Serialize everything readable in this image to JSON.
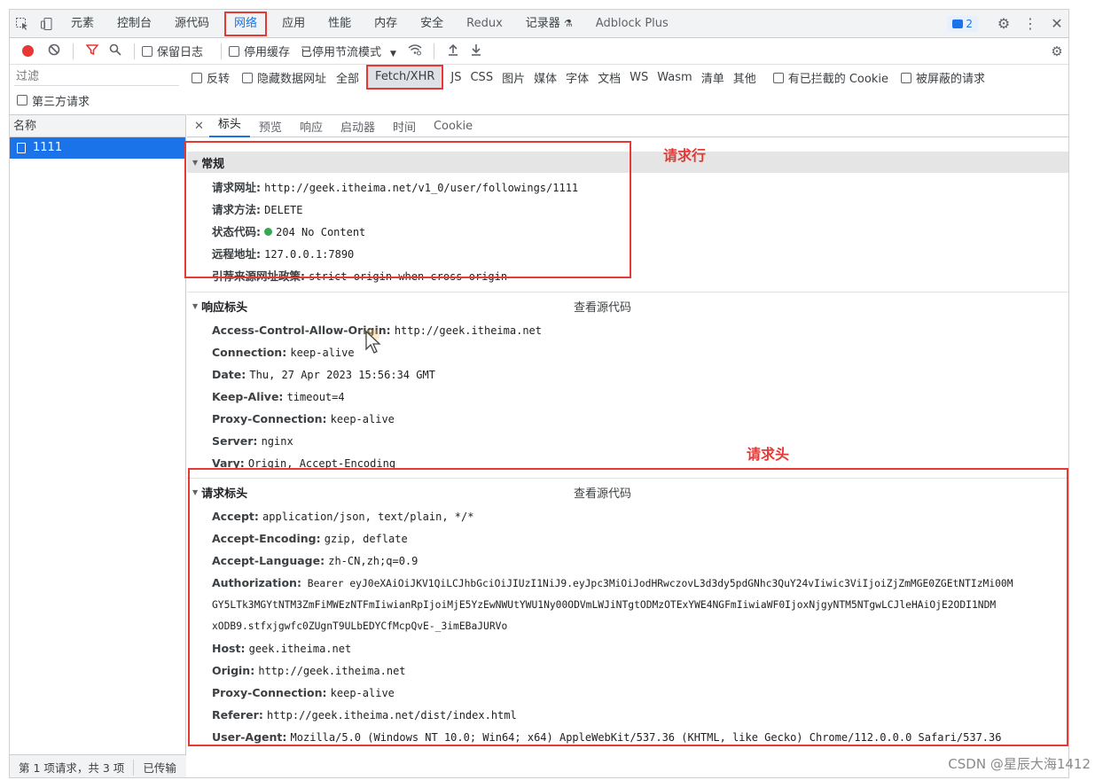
{
  "tabs": {
    "items": [
      "元素",
      "控制台",
      "源代码",
      "网络",
      "应用",
      "性能",
      "内存",
      "安全",
      "Redux",
      "记录器",
      "Adblock Plus"
    ],
    "active": "网络",
    "badge_count": "2"
  },
  "toolbar": {
    "preserve_log": "保留日志",
    "disable_cache": "停用缓存",
    "throttle": "已停用节流模式"
  },
  "filter": {
    "placeholder": "过滤",
    "invert": "反转",
    "hide_data_urls": "隐藏数据网址",
    "types": [
      "全部",
      "Fetch/XHR",
      "JS",
      "CSS",
      "图片",
      "媒体",
      "字体",
      "文档",
      "WS",
      "Wasm",
      "清单",
      "其他"
    ],
    "active_type": "Fetch/XHR",
    "blocked_cookies": "有已拦截的 Cookie",
    "blocked_requests": "被屏蔽的请求",
    "third_party": "第三方请求"
  },
  "list": {
    "header": "名称",
    "request_name": "1111"
  },
  "status": {
    "summary": "第 1 项请求，共 3 项",
    "transferred": "已传输"
  },
  "detail_tabs": [
    "标头",
    "预览",
    "响应",
    "启动器",
    "时间",
    "Cookie"
  ],
  "general": {
    "title": "常规",
    "request_url_key": "请求网址:",
    "request_url": "http://geek.itheima.net/v1_0/user/followings/1111",
    "method_key": "请求方法:",
    "method": "DELETE",
    "status_key": "状态代码:",
    "status": "204 No Content",
    "remote_key": "远程地址:",
    "remote": "127.0.0.1:7890",
    "referrer_policy_key": "引荐来源网址政策:",
    "referrer_policy": "strict-origin-when-cross-origin"
  },
  "response_headers": {
    "title": "响应标头",
    "view_source": "查看源代码",
    "items": [
      {
        "k": "Access-Control-Allow-Origin:",
        "v": "http://geek.itheima.net"
      },
      {
        "k": "Connection:",
        "v": "keep-alive"
      },
      {
        "k": "Date:",
        "v": "Thu, 27 Apr 2023 15:56:34 GMT"
      },
      {
        "k": "Keep-Alive:",
        "v": "timeout=4"
      },
      {
        "k": "Proxy-Connection:",
        "v": "keep-alive"
      },
      {
        "k": "Server:",
        "v": "nginx"
      },
      {
        "k": "Vary:",
        "v": "Origin, Accept-Encoding"
      }
    ]
  },
  "request_headers": {
    "title": "请求标头",
    "view_source": "查看源代码",
    "accept_k": "Accept:",
    "accept_v": "application/json, text/plain, */*",
    "accept_enc_k": "Accept-Encoding:",
    "accept_enc_v": "gzip, deflate",
    "accept_lang_k": "Accept-Language:",
    "accept_lang_v": "zh-CN,zh;q=0.9",
    "auth_k": "Authorization:",
    "auth_v1": "Bearer eyJ0eXAiOiJKV1QiLCJhbGciOiJIUzI1NiJ9.eyJpc3MiOiJodHRwczovL3d3dy5pdGNhc3QuY24vIiwic3ViIjoiZjZmMGE0ZGEtNTIzMi00M",
    "auth_v2": "GY5LTk3MGYtNTM3ZmFiMWEzNTFmIiwianRpIjoiMjE5YzEwNWUtYWU1Ny00ODVmLWJiNTgtODMzOTExYWE4NGFmIiwiaWF0IjoxNjgyNTM5NTgwLCJleHAiOjE2ODI1NDM",
    "auth_v3": "xODB9.stfxjgwfc0ZUgnT9ULbEDYCfMcpQvE-_3imEBaJURVo",
    "host_k": "Host:",
    "host_v": "geek.itheima.net",
    "origin_k": "Origin:",
    "origin_v": "http://geek.itheima.net",
    "proxy_k": "Proxy-Connection:",
    "proxy_v": "keep-alive",
    "referer_k": "Referer:",
    "referer_v": "http://geek.itheima.net/dist/index.html",
    "ua_k": "User-Agent:",
    "ua_v": "Mozilla/5.0 (Windows NT 10.0; Win64; x64) AppleWebKit/537.36 (KHTML, like Gecko) Chrome/112.0.0.0 Safari/537.36"
  },
  "annotations": {
    "request_line": "请求行",
    "request_headers": "请求头"
  },
  "watermark": "CSDN @星辰大海1412",
  "colors": {
    "accent": "#1a73e8",
    "highlight_box": "#e53935",
    "status_ok": "#34a853"
  }
}
